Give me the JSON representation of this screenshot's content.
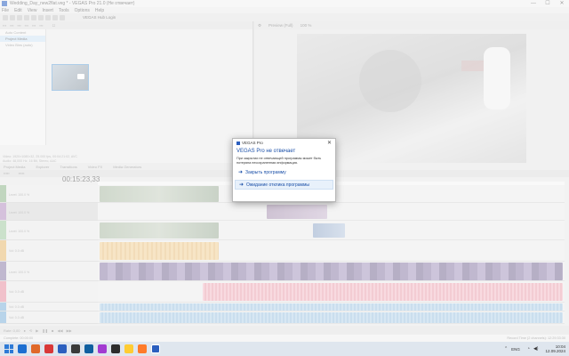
{
  "window": {
    "title": "Wedding_Day_new2flat.veg * - VEGAS Pro 21.0 (Не отвечает)",
    "buttons": [
      "—",
      "☐",
      "✕"
    ]
  },
  "menu": [
    "File",
    "Edit",
    "View",
    "Insert",
    "Tools",
    "Options",
    "Help"
  ],
  "toolbar": {
    "hub_label": "VEGAS Hub Login"
  },
  "media": {
    "tree": [
      "Auto Content",
      "Project Media",
      "Video Bins (auto)"
    ],
    "selected": "Project Media",
    "info_line1": "Video: 1920×1080×32, 25.000 fps, 00:04:21:02, AVC",
    "info_line2": "Audio: 48,000 Hz, 16 Bit, Stereo, AAC"
  },
  "media_tabs": [
    "Project Media",
    "Explorer",
    "Transitions",
    "Video FX",
    "Media Generators"
  ],
  "preview": {
    "mode": "Preview (Full)",
    "zoom": "100 %"
  },
  "timeline": {
    "timecode": "00:15:23,33",
    "track_levels": [
      "Level: 100.0 %",
      "Level: 100.0 %",
      "Level: 100.0 %",
      "Vol: 0.0 dB",
      "Level: 100.0 %",
      "Vol: 0.0 dB",
      "Vol: 0.0 dB",
      "Vol: 0.0 dB"
    ],
    "rate": "Rate: 0,00"
  },
  "status": {
    "left": "Complete: 00:00:00",
    "right": "Record Time (2 channels): 12:29:33:30"
  },
  "dialog": {
    "title": "VEGAS Pro",
    "close": "✕",
    "heading": "VEGAS Pro не отвечает",
    "message": "При закрытии не отвечающей программы может быть потеряна несохраненная информация.",
    "option_close": "Закрыть программу",
    "option_wait": "Ожидание отклика программы"
  },
  "taskbar": {
    "lang": "ENG",
    "time": "10:04",
    "date": "12.09.2024",
    "apps_colors": [
      "#1d6fd1",
      "#e0692a",
      "#d93838",
      "#2b5fbf",
      "#3a3a3a",
      "#0f5fa0",
      "#a23bd1",
      "#2d2d2d",
      "#ffcc33",
      "#ff7b2a",
      "#2b5fbf"
    ]
  }
}
